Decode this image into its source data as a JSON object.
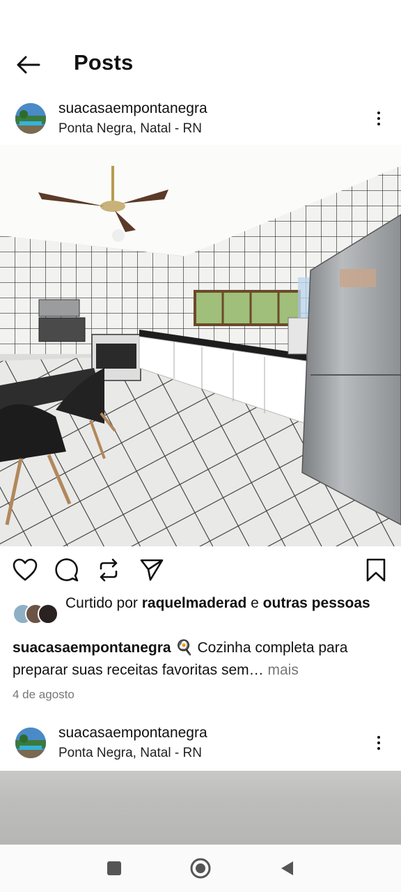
{
  "header": {
    "title": "Posts"
  },
  "post": {
    "username": "suacasaempontanegra",
    "location": "Ponta Negra, Natal - RN",
    "liked_prefix": "Curtido por",
    "liked_user": "raquelmaderad",
    "liked_and": "e",
    "liked_others": "outras pessoas",
    "caption_user": "suacasaempontanegra",
    "caption_emoji": "🍳",
    "caption_text": "Cozinha completa para preparar suas receitas favoritas sem…",
    "caption_more": "mais",
    "date": "4 de agosto"
  },
  "post2": {
    "username": "suacasaempontanegra",
    "location": "Ponta Negra, Natal - RN"
  },
  "icons": {
    "back": "arrow-left-icon",
    "more": "more-vertical-icon",
    "like": "heart-icon",
    "comment": "comment-icon",
    "repost": "repost-icon",
    "share": "send-icon",
    "save": "bookmark-icon",
    "nav_recents": "square-icon",
    "nav_home": "circle-icon",
    "nav_back": "triangle-back-icon"
  }
}
